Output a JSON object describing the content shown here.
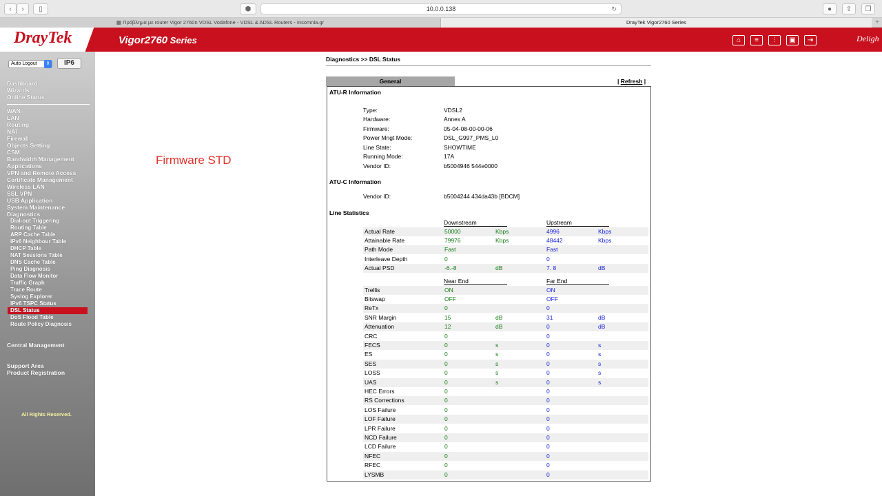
{
  "browser": {
    "url": "10.0.0.138",
    "tabs": [
      {
        "label": "▦ Πρόβλημα με router Vigor 2760n VDSL Vodafone - VDSL & ADSL Routers - Insomnia.gr"
      },
      {
        "label": "DrayTek Vigor2760 Series"
      }
    ]
  },
  "header": {
    "brand": "DrayTek",
    "model_main": "Vigor2760",
    "model_suffix": " Series",
    "tagline": "Deligh"
  },
  "sidebar": {
    "auto_logout": "Auto Logout",
    "ipv6": "IP6",
    "items": [
      {
        "label": "Dashboard"
      },
      {
        "label": "Wizards"
      },
      {
        "label": "Online Status"
      },
      {
        "label": "WAN"
      },
      {
        "label": "LAN"
      },
      {
        "label": "Routing"
      },
      {
        "label": "NAT"
      },
      {
        "label": "Firewall"
      },
      {
        "label": "Objects Setting"
      },
      {
        "label": "CSM"
      },
      {
        "label": "Bandwidth Management"
      },
      {
        "label": "Applications"
      },
      {
        "label": "VPN and Remote Access"
      },
      {
        "label": "Certificate Management"
      },
      {
        "label": "Wireless LAN"
      },
      {
        "label": "SSL VPN"
      },
      {
        "label": "USB Application"
      },
      {
        "label": "System Maintenance"
      },
      {
        "label": "Diagnostics"
      }
    ],
    "diag_items": [
      {
        "label": "Dial-out Triggering"
      },
      {
        "label": "Routing Table"
      },
      {
        "label": "ARP Cache Table"
      },
      {
        "label": "IPv6 Neighbour Table"
      },
      {
        "label": "DHCP Table"
      },
      {
        "label": "NAT Sessions Table"
      },
      {
        "label": "DNS Cache Table"
      },
      {
        "label": "Ping Diagnosis"
      },
      {
        "label": "Data Flow Monitor"
      },
      {
        "label": "Traffic Graph"
      },
      {
        "label": "Trace Route"
      },
      {
        "label": "Syslog Explorer"
      },
      {
        "label": "IPv6 TSPC Status"
      },
      {
        "label": "DSL Status"
      },
      {
        "label": "DoS Flood Table"
      },
      {
        "label": "Route Policy Diagnosis"
      }
    ],
    "central": "Central Management",
    "support": "Support Area",
    "registration": "Product Registration",
    "rights": "All Rights Reserved."
  },
  "annotation": "Firmware STD",
  "main": {
    "breadcrumb": "Diagnostics >> DSL Status",
    "tab_general": "General",
    "refresh_prefix": "|",
    "refresh": "Refresh",
    "refresh_suffix": "|",
    "atur_title": "ATU-R Information",
    "atur": [
      {
        "label": "Type:",
        "value": "VDSL2"
      },
      {
        "label": "Hardware:",
        "value": "Annex A"
      },
      {
        "label": "Firmware:",
        "value": "05-04-08-00-00-06"
      },
      {
        "label": "Power Mngt Mode:",
        "value": "DSL_G997_PMS_L0"
      },
      {
        "label": "Line State:",
        "value": "SHOWTIME"
      },
      {
        "label": "Running Mode:",
        "value": "17A"
      },
      {
        "label": "Vendor ID:",
        "value": "b5004946 544e0000"
      }
    ],
    "atuc_title": "ATU-C Information",
    "atuc": [
      {
        "label": "Vendor ID:",
        "value": "b5004244 434da43b [BDCM]"
      }
    ],
    "line_title": "Line Statistics",
    "hdr1": {
      "left": "Downstream",
      "right": "Upstream"
    },
    "rows1": [
      {
        "label": "Actual Rate",
        "dn": "50000",
        "dnu": "Kbps",
        "up": "4996",
        "upu": "Kbps"
      },
      {
        "label": "Attainable Rate",
        "dn": "79976",
        "dnu": "Kbps",
        "up": "48442",
        "upu": "Kbps"
      },
      {
        "label": "Path Mode",
        "dn": "Fast",
        "dnu": "",
        "up": "Fast",
        "upu": ""
      },
      {
        "label": "Interleave Depth",
        "dn": "0",
        "dnu": "",
        "up": "0",
        "upu": ""
      },
      {
        "label": "Actual PSD",
        "dn": "-6.-8",
        "dnu": "dB",
        "up": "7. 8",
        "upu": "dB"
      }
    ],
    "hdr2": {
      "left": "Near End",
      "right": "Far End"
    },
    "rows2": [
      {
        "label": "Trellis",
        "dn": "ON",
        "dnu": "",
        "up": "ON",
        "upu": ""
      },
      {
        "label": "Bitswap",
        "dn": "OFF",
        "dnu": "",
        "up": "OFF",
        "upu": ""
      },
      {
        "label": "ReTx",
        "dn": "0",
        "dnu": "",
        "up": "0",
        "upu": ""
      },
      {
        "label": "SNR Margin",
        "dn": "15",
        "dnu": "dB",
        "up": "31",
        "upu": "dB"
      },
      {
        "label": "Attenuation",
        "dn": "12",
        "dnu": "dB",
        "up": "0",
        "upu": "dB"
      },
      {
        "label": "CRC",
        "dn": "0",
        "dnu": "",
        "up": "0",
        "upu": ""
      },
      {
        "label": "FECS",
        "dn": "0",
        "dnu": "s",
        "up": "0",
        "upu": "s"
      },
      {
        "label": "ES",
        "dn": "0",
        "dnu": "s",
        "up": "0",
        "upu": "s"
      },
      {
        "label": "SES",
        "dn": "0",
        "dnu": "s",
        "up": "0",
        "upu": "s"
      },
      {
        "label": "LOSS",
        "dn": "0",
        "dnu": "s",
        "up": "0",
        "upu": "s"
      },
      {
        "label": "UAS",
        "dn": "0",
        "dnu": "s",
        "up": "0",
        "upu": "s"
      },
      {
        "label": "HEC Errors",
        "dn": "0",
        "dnu": "",
        "up": "0",
        "upu": ""
      },
      {
        "label": "RS Corrections",
        "dn": "0",
        "dnu": "",
        "up": "0",
        "upu": ""
      },
      {
        "label": "LOS Failure",
        "dn": "0",
        "dnu": "",
        "up": "0",
        "upu": ""
      },
      {
        "label": "LOF Failure",
        "dn": "0",
        "dnu": "",
        "up": "0",
        "upu": ""
      },
      {
        "label": "LPR Failure",
        "dn": "0",
        "dnu": "",
        "up": "0",
        "upu": ""
      },
      {
        "label": "NCD Failure",
        "dn": "0",
        "dnu": "",
        "up": "0",
        "upu": ""
      },
      {
        "label": "LCD Failure",
        "dn": "0",
        "dnu": "",
        "up": "0",
        "upu": ""
      },
      {
        "label": "NFEC",
        "dn": "0",
        "dnu": "",
        "up": "0",
        "upu": ""
      },
      {
        "label": "RFEC",
        "dn": "0",
        "dnu": "",
        "up": "0",
        "upu": ""
      },
      {
        "label": "LYSMB",
        "dn": "0",
        "dnu": "",
        "up": "0",
        "upu": ""
      }
    ]
  }
}
